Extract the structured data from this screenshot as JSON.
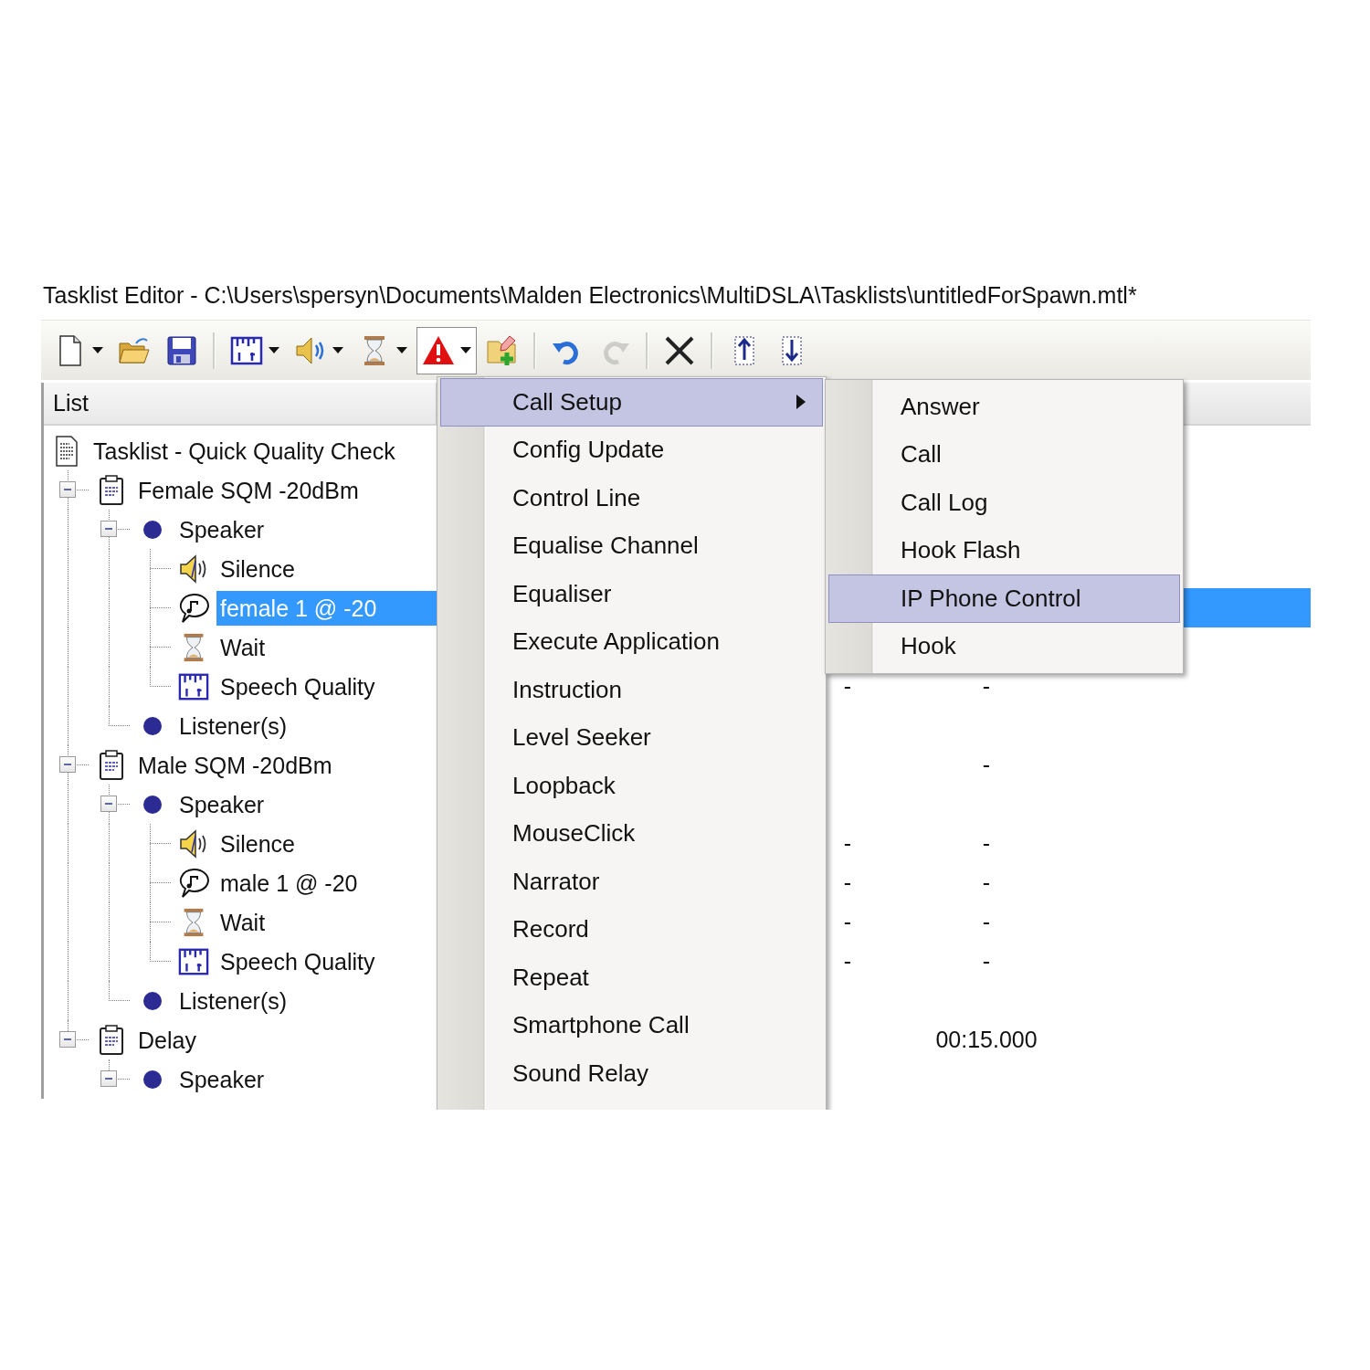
{
  "window": {
    "title": "Tasklist Editor - C:\\Users\\spersyn\\Documents\\Malden Electronics\\MultiDSLA\\Tasklists\\untitledForSpawn.mtl*"
  },
  "toolbar": [
    {
      "kind": "new",
      "dropdown": true,
      "pressed": false,
      "disabled": false
    },
    {
      "kind": "open",
      "dropdown": false,
      "pressed": false,
      "disabled": false
    },
    {
      "kind": "save",
      "dropdown": false,
      "pressed": false,
      "disabled": false
    },
    {
      "kind": "separator"
    },
    {
      "kind": "ruler",
      "dropdown": true,
      "pressed": false,
      "disabled": false
    },
    {
      "kind": "speaker",
      "dropdown": true,
      "pressed": false,
      "disabled": false
    },
    {
      "kind": "hourglass",
      "dropdown": true,
      "pressed": false,
      "disabled": false
    },
    {
      "kind": "alert",
      "dropdown": true,
      "pressed": true,
      "disabled": false
    },
    {
      "kind": "add",
      "dropdown": false,
      "pressed": false,
      "disabled": false
    },
    {
      "kind": "separator"
    },
    {
      "kind": "undo",
      "dropdown": false,
      "pressed": false,
      "disabled": false
    },
    {
      "kind": "redo",
      "dropdown": false,
      "pressed": false,
      "disabled": true
    },
    {
      "kind": "separator"
    },
    {
      "kind": "delete",
      "dropdown": false,
      "pressed": false,
      "disabled": false
    },
    {
      "kind": "separator"
    },
    {
      "kind": "move_up",
      "dropdown": false,
      "pressed": false,
      "disabled": false
    },
    {
      "kind": "move_down",
      "dropdown": false,
      "pressed": false,
      "disabled": false
    }
  ],
  "list": {
    "header": "List",
    "items": [
      {
        "label": "Tasklist - Quick Quality Check",
        "kind": "document",
        "selected": false,
        "children": [
          {
            "label": "Female SQM -20dBm",
            "kind": "clipboard",
            "selected": false,
            "expanded": true,
            "children": [
              {
                "label": "Speaker",
                "kind": "dot",
                "selected": false,
                "expanded": true,
                "children": [
                  {
                    "label": "Silence",
                    "kind": "speaker",
                    "selected": false
                  },
                  {
                    "label": "female 1 @ -20",
                    "kind": "note",
                    "selected": true
                  },
                  {
                    "label": "Wait",
                    "kind": "hourglass",
                    "selected": false
                  },
                  {
                    "label": "Speech Quality",
                    "kind": "ruler",
                    "selected": false,
                    "column_2": "-",
                    "column_3": "-"
                  }
                ]
              },
              {
                "label": "Listener(s)",
                "kind": "dot",
                "selected": false
              }
            ]
          },
          {
            "label": "Male SQM -20dBm",
            "kind": "clipboard",
            "selected": false,
            "expanded": true,
            "column_3": "-",
            "children": [
              {
                "label": "Speaker",
                "kind": "dot",
                "selected": false,
                "expanded": true,
                "children": [
                  {
                    "label": "Silence",
                    "kind": "speaker",
                    "selected": false,
                    "column_2": "-",
                    "column_3": "-"
                  },
                  {
                    "label": "male 1 @ -20",
                    "kind": "note",
                    "selected": false,
                    "column_2": "-",
                    "column_3": "-"
                  },
                  {
                    "label": "Wait",
                    "kind": "hourglass",
                    "selected": false,
                    "column_2": "-",
                    "column_3": "-"
                  },
                  {
                    "label": "Speech Quality",
                    "kind": "ruler",
                    "selected": false,
                    "column_2": "-",
                    "column_3": "-"
                  }
                ]
              },
              {
                "label": "Listener(s)",
                "kind": "dot",
                "selected": false
              }
            ]
          },
          {
            "label": "Delay",
            "kind": "clipboard",
            "selected": false,
            "expanded": true,
            "column_3": "00:15.000",
            "children": [
              {
                "label": "Speaker",
                "kind": "dot",
                "selected": false,
                "expanded": true
              }
            ]
          }
        ]
      }
    ]
  },
  "menu": {
    "items": [
      {
        "label": "Call Setup",
        "selected": true,
        "submenu": true
      },
      {
        "label": "Config Update",
        "selected": false,
        "submenu": false
      },
      {
        "label": "Control Line",
        "selected": false,
        "submenu": false
      },
      {
        "label": "Equalise Channel",
        "selected": false,
        "submenu": false
      },
      {
        "label": "Equaliser",
        "selected": false,
        "submenu": false
      },
      {
        "label": "Execute Application",
        "selected": false,
        "submenu": false
      },
      {
        "label": "Instruction",
        "selected": false,
        "submenu": false
      },
      {
        "label": "Level Seeker",
        "selected": false,
        "submenu": false
      },
      {
        "label": "Loopback",
        "selected": false,
        "submenu": false
      },
      {
        "label": "MouseClick",
        "selected": false,
        "submenu": false
      },
      {
        "label": "Narrator",
        "selected": false,
        "submenu": false
      },
      {
        "label": "Record",
        "selected": false,
        "submenu": false
      },
      {
        "label": "Repeat",
        "selected": false,
        "submenu": false
      },
      {
        "label": "Smartphone Call",
        "selected": false,
        "submenu": false
      },
      {
        "label": "Sound Relay",
        "selected": false,
        "submenu": false
      }
    ]
  },
  "submenu": {
    "items": [
      {
        "label": "Answer",
        "selected": false
      },
      {
        "label": "Call",
        "selected": false
      },
      {
        "label": "Call Log",
        "selected": false
      },
      {
        "label": "Hook Flash",
        "selected": false
      },
      {
        "label": "IP Phone Control",
        "selected": true
      },
      {
        "label": "Hook",
        "selected": false
      }
    ]
  }
}
